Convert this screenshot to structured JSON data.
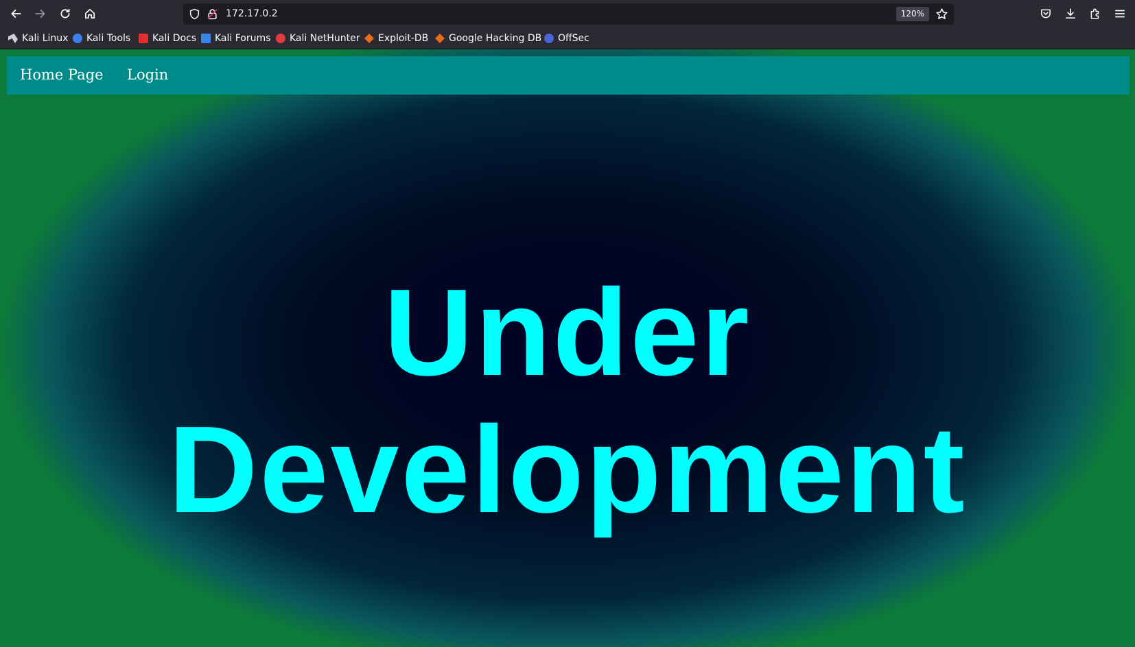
{
  "browser": {
    "url": "172.17.0.2",
    "zoom": "120%",
    "bookmarks": [
      {
        "label": "Kali Linux",
        "icon": "kali-dragon-icon",
        "color": "#cfd0d8"
      },
      {
        "label": "Kali Tools",
        "icon": "kali-tools-icon",
        "color": "#3d7ee6"
      },
      {
        "label": "Kali Docs",
        "icon": "kali-docs-icon",
        "color": "#e03030"
      },
      {
        "label": "Kali Forums",
        "icon": "kali-forums-icon",
        "color": "#3a86e8"
      },
      {
        "label": "Kali NetHunter",
        "icon": "nethunter-icon",
        "color": "#e0393e"
      },
      {
        "label": "Exploit-DB",
        "icon": "exploit-db-icon",
        "color": "#f06a1d"
      },
      {
        "label": "Google Hacking DB",
        "icon": "ghdb-icon",
        "color": "#f06a1d"
      },
      {
        "label": "OffSec",
        "icon": "offsec-icon",
        "color": "#4a63d6"
      }
    ]
  },
  "page": {
    "nav": {
      "home_label": "Home Page",
      "login_label": "Login",
      "color": "#008b8b"
    },
    "headline": {
      "line1": "Under",
      "line2": "Development",
      "color": "#00ffff"
    }
  }
}
